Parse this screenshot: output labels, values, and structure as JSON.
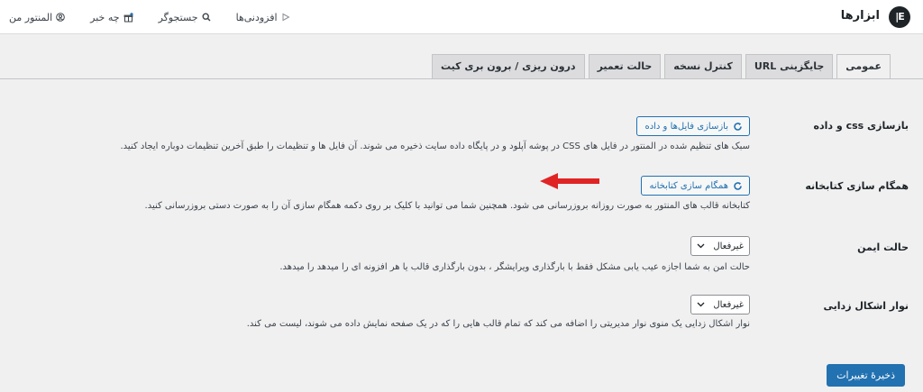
{
  "header": {
    "title": "ابزارها",
    "nav": {
      "account": "المنتور من",
      "whats_new": "چه خبر",
      "search": "جستجوگر",
      "addons": "افزودنی‌ها"
    }
  },
  "tabs": [
    {
      "label": "عمومی",
      "active": true
    },
    {
      "label": "جایگزینی URL",
      "active": false
    },
    {
      "label": "کنترل نسخه",
      "active": false
    },
    {
      "label": "حالت تعمیر",
      "active": false
    },
    {
      "label": "درون ریزی / برون بری کیت",
      "active": false
    }
  ],
  "settings": {
    "css": {
      "label": "بازسازی css و داده",
      "button": "بازسازی فایل‌ها و داده",
      "description": "سبک های تنظیم شده در المنتور در فایل های CSS در پوشه آپلود و در پایگاه داده سایت ذخیره می شوند. آن فایل ها و تنظیمات را طبق آخرین تنظیمات دوباره ایجاد کنید."
    },
    "library": {
      "label": "همگام سازی کتابخانه",
      "button": "همگام سازی کتابخانه",
      "description": "کتابخانه قالب های المنتور به صورت روزانه بروزرسانی می شود. همچنین شما می توانید با کلیک بر روی دکمه همگام سازی آن را به صورت دستی بروزرسانی کنید."
    },
    "safe_mode": {
      "label": "حالت ایمن",
      "value": "غیرفعال",
      "description": "حالت امن به شما اجازه عیب یابی مشکل فقط با بارگذاری ویرایشگر ، بدون بارگذاری قالب یا هر افزونه ای را میدهد را میدهد."
    },
    "debug_bar": {
      "label": "نوار اشکال زدایی",
      "value": "غیرفعال",
      "description": "نوار اشکال زدایی یک منوی نوار مدیریتی را اضافه می کند که تمام قالب هایی را که در یک صفحه نمایش داده می شوند، لیست می کند."
    }
  },
  "save_label": "ذخیرهٔ تغییرات",
  "colors": {
    "accent": "#2271b1",
    "arrow": "#e02424",
    "background": "#f0f0f1"
  }
}
